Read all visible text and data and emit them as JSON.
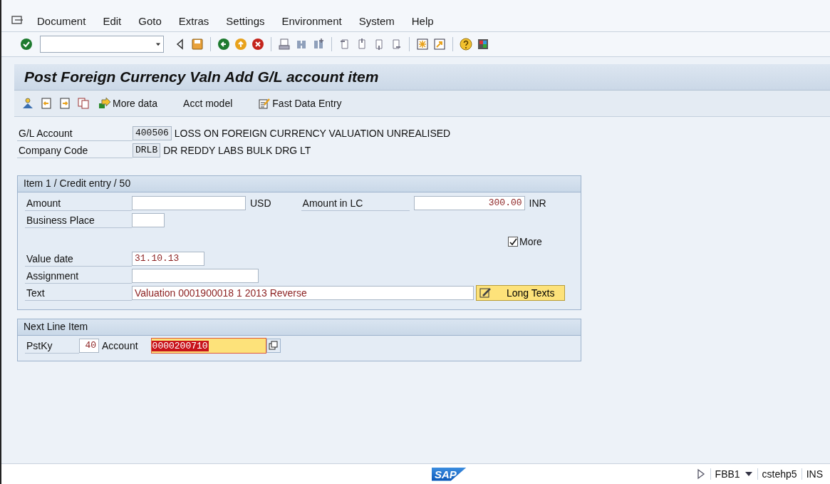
{
  "menu": [
    "Document",
    "Edit",
    "Goto",
    "Extras",
    "Settings",
    "Environment",
    "System",
    "Help"
  ],
  "title": "Post Foreign Currency Valn Add G/L account item",
  "app_toolbar": [
    {
      "label": "More data"
    },
    {
      "label": "Acct model"
    },
    {
      "label": "Fast Data Entry"
    }
  ],
  "header_fields": [
    {
      "label": "G/L Account",
      "value": "400506",
      "description": "LOSS ON FOREIGN CURRENCY VALUATION UNREALISED"
    },
    {
      "label": "Company Code",
      "value": "DRLB",
      "description": "DR REDDY LABS BULK DRG LT"
    }
  ],
  "item_group": {
    "title": "Item 1 / Credit entry / 50",
    "amount_label": "Amount",
    "amount_currency": "USD",
    "lc_label": "Amount in LC",
    "lc_value": "300.00",
    "lc_currency": "INR",
    "business_place_label": "Business Place",
    "more": {
      "label": "More",
      "checked": true
    },
    "value_date_label": "Value date",
    "value_date": "31.10.13",
    "assignment_label": "Assignment",
    "text_label": "Text",
    "text_value": "Valuation 0001900018 1 2013 Reverse",
    "long_texts_button": "Long Texts"
  },
  "next_item": {
    "title": "Next Line Item",
    "pstky_label": "PstKy",
    "pstky": "40",
    "account_label": "Account",
    "account": "0000200710",
    "selected": true
  },
  "status_bar": {
    "logo": "SAP",
    "transaction": "FBB1",
    "server": "cstehp5",
    "mode": "INS"
  }
}
